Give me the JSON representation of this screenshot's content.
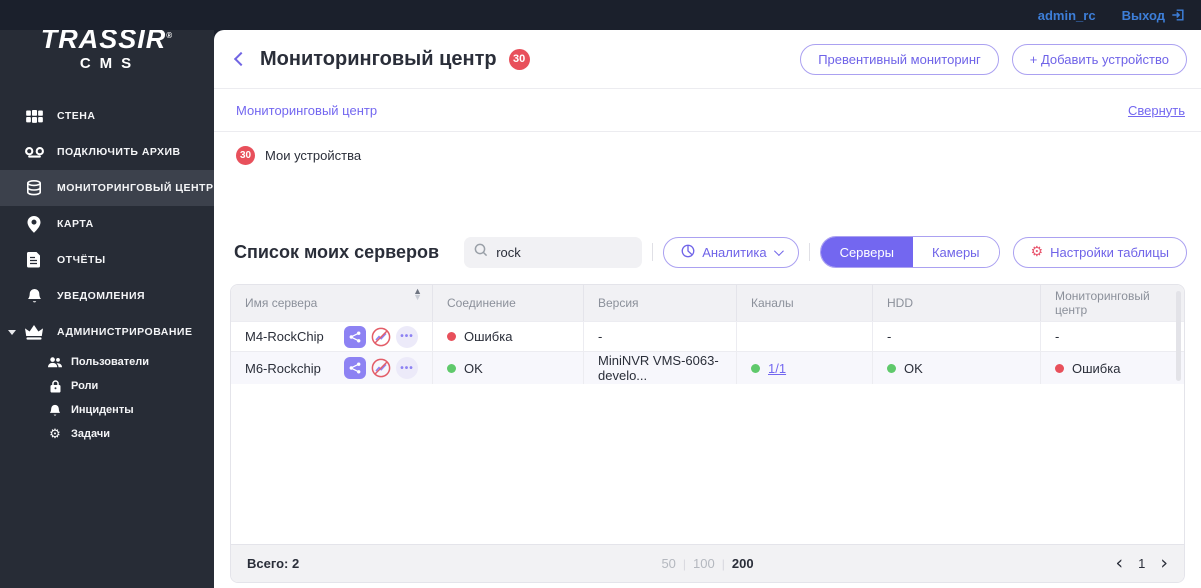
{
  "topbar": {
    "username": "admin_rc",
    "logout_label": "Выход"
  },
  "sidebar": {
    "logo_title": "TRASSIR",
    "logo_mark": "®",
    "logo_subtitle": "CMS",
    "items": [
      {
        "label": "Стена"
      },
      {
        "label": "Подключить архив"
      },
      {
        "label": "Мониторинговый центр",
        "active": true
      },
      {
        "label": "Карта"
      },
      {
        "label": "Отчёты"
      },
      {
        "label": "Уведомления"
      },
      {
        "label": "Администрирование",
        "expanded": true
      }
    ],
    "admin_subitems": [
      {
        "label": "Пользователи"
      },
      {
        "label": "Роли"
      },
      {
        "label": "Инциденты"
      },
      {
        "label": "Задачи"
      }
    ]
  },
  "header": {
    "title": "Мониторинговый центр",
    "badge": "30",
    "buttons": {
      "preventive": "Превентивный мониторинг",
      "add_device": "+ Добавить устройство"
    }
  },
  "breadcrumb": {
    "current": "Мониторинговый центр",
    "collapse_label": "Свернуть"
  },
  "devices_group": {
    "badge": "30",
    "label": "Мои устройства"
  },
  "server_list": {
    "title": "Список моих серверов",
    "search": {
      "value": "rock"
    },
    "analytics_label": "Аналитика",
    "toggle": {
      "servers": "Серверы",
      "cameras": "Камеры"
    },
    "table_settings_label": "Настройки таблицы"
  },
  "table": {
    "columns": [
      "Имя сервера",
      "Соединение",
      "Версия",
      "Каналы",
      "HDD",
      "Мониторинговый центр"
    ],
    "rows": [
      {
        "name": "M4-RockChip",
        "connection": {
          "status": "error",
          "label": "Ошибка"
        },
        "version": "-",
        "channels": "",
        "hdd": "-",
        "monitoring": "-"
      },
      {
        "name": "M6-Rockchip",
        "connection": {
          "status": "ok",
          "label": "OK"
        },
        "version": "MiniNVR VMS-6063-develo...",
        "channels": {
          "status": "ok",
          "label": "1/1"
        },
        "hdd": {
          "status": "ok",
          "label": "OK"
        },
        "monitoring": {
          "status": "error",
          "label": "Ошибка"
        }
      }
    ]
  },
  "footer": {
    "total_label": "Всего: 2",
    "page_sizes": [
      "50",
      "100",
      "200"
    ],
    "active_page_size": "200",
    "current_page": "1"
  },
  "colors": {
    "accent_purple": "#7367f0",
    "error_red": "#e8505b",
    "ok_green": "#5fc96b",
    "link_blue": "#3d7ed8",
    "sidebar_bg": "#272c36",
    "topbar_bg": "#1b202c"
  }
}
